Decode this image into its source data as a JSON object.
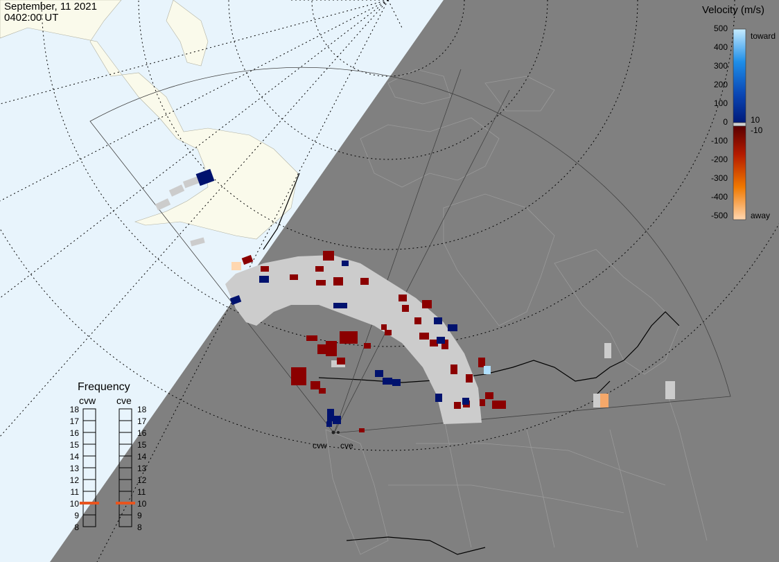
{
  "header": {
    "date": "September, 11 2021",
    "time": "0402:00 UT"
  },
  "velocity_scale": {
    "title": "Velocity (m/s)",
    "ticks": [
      "500",
      "400",
      "300",
      "200",
      "100",
      "0",
      "-100",
      "-200",
      "-300",
      "-400",
      "-500"
    ],
    "toward_label": "toward",
    "away_label": "away",
    "threshold_pos": "10",
    "threshold_neg": "-10",
    "colors": {
      "toward_light": "#c6ecff",
      "toward_mid": "#1e8ee8",
      "toward_dark": "#001a7a",
      "ground_scatter": "#cccccc",
      "away_dark": "#8b0000",
      "away_mid": "#e85a00",
      "away_light": "#ffd7b0"
    }
  },
  "frequency": {
    "title": "Frequency",
    "radars": [
      {
        "name": "cvw",
        "frequency_mhz": 10.5
      },
      {
        "name": "cve",
        "frequency_mhz": 10.5
      }
    ],
    "scale": [
      "18",
      "17",
      "16",
      "15",
      "14",
      "13",
      "12",
      "11",
      "10",
      "9",
      "8"
    ],
    "indicator_color": "#e8541e"
  },
  "map": {
    "radar_sites": [
      "cvw",
      "cve"
    ],
    "night_shade_color": "#808080",
    "land_day_color": "#fafaeb",
    "ocean_day_color": "#e8f4fc"
  }
}
